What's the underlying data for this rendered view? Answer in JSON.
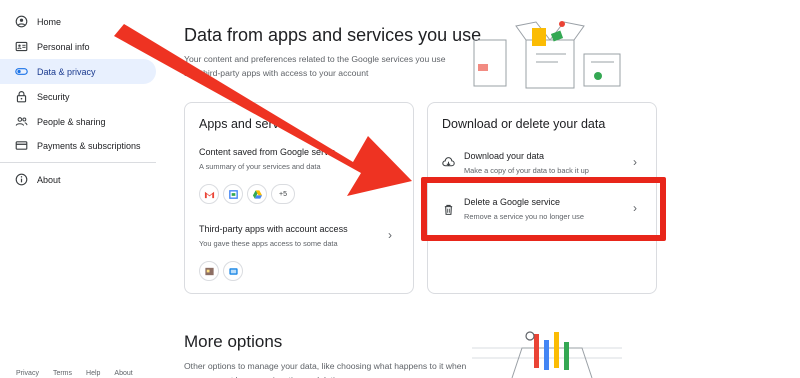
{
  "sidebar": {
    "items": [
      {
        "label": "Home",
        "icon": "home-icon"
      },
      {
        "label": "Personal info",
        "icon": "id-card-icon"
      },
      {
        "label": "Data & privacy",
        "icon": "toggle-icon",
        "active": true
      },
      {
        "label": "Security",
        "icon": "lock-icon"
      },
      {
        "label": "People & sharing",
        "icon": "people-icon"
      },
      {
        "label": "Payments & subscriptions",
        "icon": "credit-card-icon"
      },
      {
        "label": "About",
        "icon": "info-icon"
      }
    ],
    "footer": [
      "Privacy",
      "Terms",
      "Help",
      "About"
    ]
  },
  "main": {
    "title": "Data from apps and services you use",
    "description": "Your content and preferences related to the Google services you use and third-party apps with access to your account"
  },
  "apps_card": {
    "title": "Apps and servi",
    "content_saved": {
      "title": "Content saved from Google servic",
      "subtitle": "A summary of your services and data",
      "more_count": "+5"
    },
    "third_party": {
      "title": "Third-party apps with account access",
      "subtitle": "You gave these apps access to some data"
    }
  },
  "download_card": {
    "title": "Download or delete your data",
    "download": {
      "title": "Download your data",
      "subtitle": "Make a copy of your data to back it up"
    },
    "delete": {
      "title": "Delete a Google service",
      "subtitle": "Remove a service you no longer use"
    }
  },
  "more_options": {
    "title": "More options",
    "description": "Other options to manage your data, like choosing what happens to it when your account becomes inactive or deleting your"
  },
  "colors": {
    "accent_active_bg": "#e8f0fe",
    "highlight_red": "#e8261a",
    "arrow_red": "#ee3322"
  }
}
